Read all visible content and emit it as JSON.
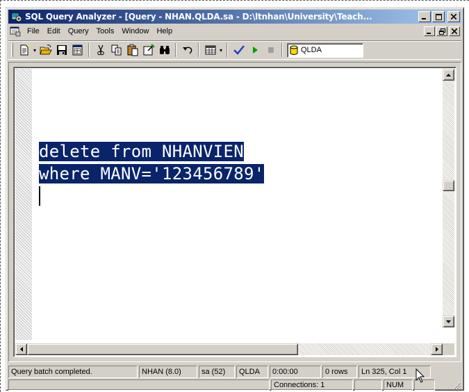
{
  "window": {
    "title": "SQL Query Analyzer - [Query - NHAN.QLDA.sa - D:\\ltnhan\\University\\Teach...",
    "title_color": "#0a246a",
    "chrome_color": "#d4d0c8"
  },
  "menu": {
    "items": [
      "File",
      "Edit",
      "Query",
      "Tools",
      "Window",
      "Help"
    ]
  },
  "toolbar": {
    "buttons": [
      {
        "icon": "new-query-icon"
      },
      {
        "icon": "open-icon"
      },
      {
        "icon": "save-icon"
      },
      {
        "icon": "insert-template-icon"
      },
      {
        "icon": "cut-icon"
      },
      {
        "icon": "copy-icon"
      },
      {
        "icon": "paste-icon"
      },
      {
        "icon": "clear-window-icon"
      },
      {
        "icon": "find-icon"
      },
      {
        "icon": "undo-icon"
      },
      {
        "icon": "results-mode-icon"
      },
      {
        "icon": "parse-query-icon"
      },
      {
        "icon": "execute-icon"
      },
      {
        "icon": "cancel-execution-icon"
      }
    ],
    "database": "QLDA"
  },
  "editor": {
    "lines": [
      "delete from NHANVIEN",
      "where MANV='123456789'"
    ],
    "selection_color": "#0a246a"
  },
  "status": {
    "message": "Query batch completed.",
    "server": "NHAN (8.0)",
    "user": "sa (52)",
    "database": "QLDA",
    "elapsed": "0:00:00",
    "rows": "0 rows",
    "position": "Ln 325, Col 1",
    "connections": "Connections: 1",
    "num": "NUM"
  }
}
